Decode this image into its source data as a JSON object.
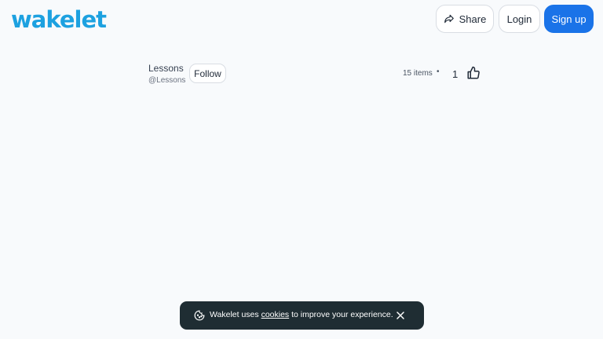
{
  "header": {
    "logo": "wakelet",
    "share_label": "Share",
    "login_label": "Login",
    "signup_label": "Sign up"
  },
  "collection": {
    "owner_name": "Lessons",
    "owner_handle": "@Lessons",
    "follow_label": "Follow",
    "items_count": "15 items",
    "separator": "•",
    "likes": "1"
  },
  "cookie_banner": {
    "text_before": "Wakelet uses ",
    "link_text": "cookies",
    "text_after": " to improve your experience."
  },
  "colors": {
    "brand": "#1da1e0",
    "primary_button": "#1a73e8",
    "banner_bg": "#1f2d33"
  }
}
